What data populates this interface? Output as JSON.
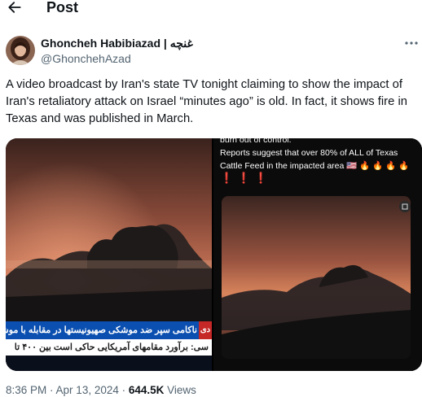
{
  "header": {
    "title": "Post",
    "back_icon": "arrow-left-icon"
  },
  "author": {
    "name": "Ghoncheh Habibiazad | غنچه",
    "handle": "@GhonchehAzad",
    "avatar_icon": "user-photo-avatar",
    "more_icon": "more-horizontal-icon"
  },
  "tweet": {
    "text": "A video broadcast by Iran's state TV tonight claiming to show the impact of Iran's retaliatory attack on Israel “minutes ago” is old. In fact, it shows fire in Texas and was published in March."
  },
  "media": {
    "left": {
      "ticker_line1": "ناکامی سپر ضد موشکی صهیونیستها در مقابله با موشک",
      "ticker_tag": "دی",
      "ticker_line2": "سی: برآورد مقامهای آمریکایی حاکی است بین ۴۰۰ تا"
    },
    "right": {
      "caption_line1": "burn out of control.",
      "caption_line2": "Reports suggest that over 80% of ALL of Texas",
      "caption_line3": "Cattle Feed in the impacted area 🇺🇸 🔥 🔥 🔥 🔥",
      "caption_line4": "❗❗❗"
    }
  },
  "meta": {
    "time": "8:36 PM",
    "separator1": " · ",
    "date": "Apr 13, 2024",
    "separator2": " · ",
    "views_count": "644.5K",
    "views_label": " Views"
  },
  "colors": {
    "text": "#0f1419",
    "secondary": "#536471",
    "ticker_blue": "#0b4fb0",
    "ticker_red": "#c62828"
  }
}
